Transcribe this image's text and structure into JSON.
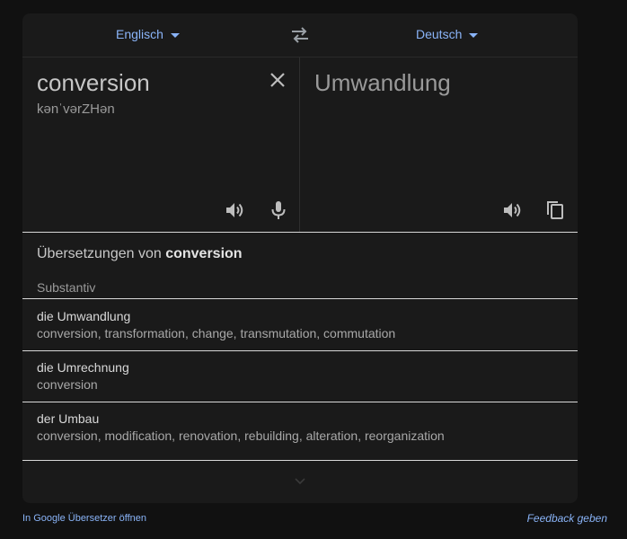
{
  "languages": {
    "source": "Englisch",
    "target": "Deutsch"
  },
  "source": {
    "text": "conversion",
    "phonetic": "kənˈvərZHən"
  },
  "target": {
    "text": "Umwandlung"
  },
  "dictionary": {
    "title_prefix": "Übersetzungen von ",
    "title_word": "conversion",
    "part_of_speech": "Substantiv",
    "entries": [
      {
        "term": "die Umwandlung",
        "synonyms": "conversion, transformation, change, transmutation, commutation"
      },
      {
        "term": "die Umrechnung",
        "synonyms": "conversion"
      },
      {
        "term": "der Umbau",
        "synonyms": "conversion, modification, renovation, rebuilding, alteration, reorganization"
      }
    ]
  },
  "footer": {
    "open_link": "In Google Übersetzer öffnen",
    "feedback": "Feedback geben"
  },
  "colors": {
    "accent": "#8ab4f8",
    "background": "#111111",
    "card": "#1a1a1a"
  },
  "icons": [
    "caret-down-icon",
    "swap-icon",
    "close-icon",
    "speaker-icon",
    "microphone-icon",
    "copy-icon",
    "chevron-down-icon"
  ]
}
